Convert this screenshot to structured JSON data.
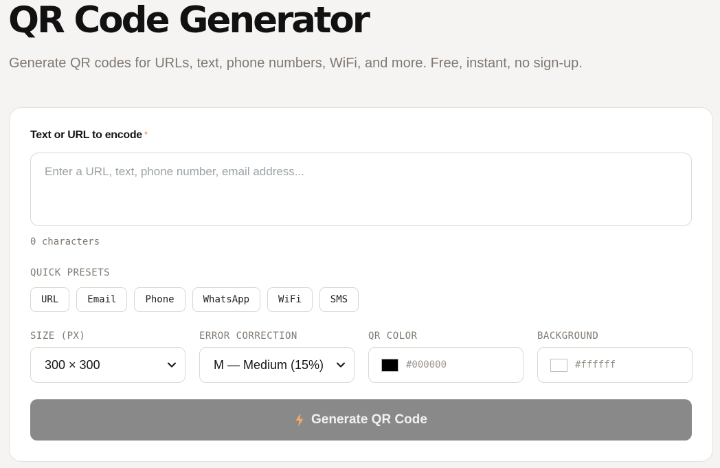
{
  "header": {
    "title": "QR Code Generator",
    "subtitle": "Generate QR codes for URLs, text, phone numbers, WiFi, and more. Free, instant, no sign-up."
  },
  "form": {
    "input_label": "Text or URL to encode",
    "required_mark": "*",
    "input_value": "",
    "input_placeholder": "Enter a URL, text, phone number, email address...",
    "char_count": "0 characters",
    "presets_label": "QUICK PRESETS",
    "presets": [
      "URL",
      "Email",
      "Phone",
      "WhatsApp",
      "WiFi",
      "SMS"
    ],
    "size": {
      "label": "SIZE (PX)",
      "value": "300 × 300"
    },
    "error_correction": {
      "label": "ERROR CORRECTION",
      "value": "M — Medium (15%)"
    },
    "qr_color": {
      "label": "QR COLOR",
      "value": "#000000"
    },
    "background": {
      "label": "BACKGROUND",
      "value": "#ffffff"
    },
    "generate_label": "Generate QR Code"
  },
  "colors": {
    "accent": "#e9874a",
    "button_disabled": "#898989",
    "page_bg": "#f6f4f3"
  },
  "icons": {
    "generate": "lightning-bolt-icon",
    "select": "chevron-down-icon"
  }
}
